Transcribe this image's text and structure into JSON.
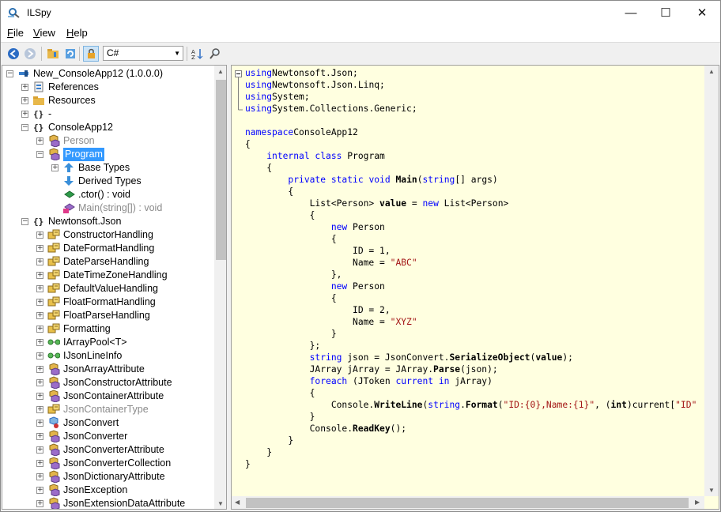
{
  "window": {
    "title": "ILSpy",
    "icon": "ilspy-magnifier-icon",
    "controls": {
      "minimize": "—",
      "maximize": "☐",
      "close": "✕"
    }
  },
  "menu": [
    {
      "label": "File",
      "key": "F",
      "rest": "ile"
    },
    {
      "label": "View",
      "key": "V",
      "rest": "iew"
    },
    {
      "label": "Help",
      "key": "H",
      "rest": "elp"
    }
  ],
  "toolbar": {
    "language": "C#",
    "icons": [
      "back-icon",
      "forward-icon",
      "open-icon",
      "reload-icon",
      "show-internal-icon",
      "sort-icon",
      "search-icon"
    ]
  },
  "tree": [
    {
      "label": "New_ConsoleApp12 (1.0.0.0)",
      "icon": "assembly-icon",
      "expander": "−",
      "style": "normal"
    },
    {
      "label": "References",
      "icon": "references-icon",
      "expander": "+",
      "style": "normal"
    },
    {
      "label": "Resources",
      "icon": "folder-icon",
      "expander": "+",
      "style": "normal"
    },
    {
      "label": "-",
      "icon": "namespace-icon",
      "expander": "+",
      "style": "normal"
    },
    {
      "label": "ConsoleApp12",
      "icon": "namespace-icon",
      "expander": "−",
      "style": "normal"
    },
    {
      "label": "Person",
      "icon": "class-icon",
      "expander": "+",
      "style": "grey"
    },
    {
      "label": "Program",
      "icon": "class-icon",
      "expander": "−",
      "style": "selected"
    },
    {
      "label": "Base Types",
      "icon": "base-types-icon",
      "expander": "+",
      "style": "normal"
    },
    {
      "label": "Derived Types",
      "icon": "derived-types-icon",
      "expander": "",
      "style": "normal"
    },
    {
      "label": ".ctor() : void",
      "icon": "method-icon",
      "expander": "",
      "style": "normal"
    },
    {
      "label": "Main(string[]) : void",
      "icon": "private-method-icon",
      "expander": "",
      "style": "grey"
    },
    {
      "label": "Newtonsoft.Json",
      "icon": "namespace-icon",
      "expander": "−",
      "style": "normal"
    },
    {
      "label": "ConstructorHandling",
      "icon": "enum-icon",
      "expander": "+",
      "style": "normal"
    },
    {
      "label": "DateFormatHandling",
      "icon": "enum-icon",
      "expander": "+",
      "style": "normal"
    },
    {
      "label": "DateParseHandling",
      "icon": "enum-icon",
      "expander": "+",
      "style": "normal"
    },
    {
      "label": "DateTimeZoneHandling",
      "icon": "enum-icon",
      "expander": "+",
      "style": "normal"
    },
    {
      "label": "DefaultValueHandling",
      "icon": "enum-icon",
      "expander": "+",
      "style": "normal"
    },
    {
      "label": "FloatFormatHandling",
      "icon": "enum-icon",
      "expander": "+",
      "style": "normal"
    },
    {
      "label": "FloatParseHandling",
      "icon": "enum-icon",
      "expander": "+",
      "style": "normal"
    },
    {
      "label": "Formatting",
      "icon": "enum-icon",
      "expander": "+",
      "style": "normal"
    },
    {
      "label": "IArrayPool<T>",
      "icon": "interface-icon",
      "expander": "+",
      "style": "normal"
    },
    {
      "label": "IJsonLineInfo",
      "icon": "interface-icon",
      "expander": "+",
      "style": "normal"
    },
    {
      "label": "JsonArrayAttribute",
      "icon": "class-icon",
      "expander": "+",
      "style": "normal"
    },
    {
      "label": "JsonConstructorAttribute",
      "icon": "class-icon",
      "expander": "+",
      "style": "normal"
    },
    {
      "label": "JsonContainerAttribute",
      "icon": "class-icon",
      "expander": "+",
      "style": "normal"
    },
    {
      "label": "JsonContainerType",
      "icon": "enum-icon",
      "expander": "+",
      "style": "grey"
    },
    {
      "label": "JsonConvert",
      "icon": "static-class-icon",
      "expander": "+",
      "style": "normal"
    },
    {
      "label": "JsonConverter",
      "icon": "class-icon",
      "expander": "+",
      "style": "normal"
    },
    {
      "label": "JsonConverterAttribute",
      "icon": "class-icon",
      "expander": "+",
      "style": "normal"
    },
    {
      "label": "JsonConverterCollection",
      "icon": "class-icon",
      "expander": "+",
      "style": "normal"
    },
    {
      "label": "JsonDictionaryAttribute",
      "icon": "class-icon",
      "expander": "+",
      "style": "normal"
    },
    {
      "label": "JsonException",
      "icon": "class-icon",
      "expander": "+",
      "style": "normal"
    },
    {
      "label": "JsonExtensionDataAttribute",
      "icon": "class-icon",
      "expander": "+",
      "style": "normal"
    }
  ],
  "code_lines": [
    [
      [
        "kw",
        "using"
      ],
      [
        "",
        "Newtonsoft.Json;"
      ]
    ],
    [
      [
        "kw",
        "using"
      ],
      [
        "",
        "Newtonsoft.Json.Linq;"
      ]
    ],
    [
      [
        "kw",
        "using"
      ],
      [
        "",
        "System;"
      ]
    ],
    [
      [
        "kw",
        "using"
      ],
      [
        "",
        "System.Collections.Generic;"
      ]
    ],
    [],
    [
      [
        "kw",
        "namespace"
      ],
      [
        "",
        "ConsoleApp12"
      ]
    ],
    [
      [
        "",
        "{"
      ]
    ],
    [
      [
        "",
        "    "
      ],
      [
        "kw",
        "internal class"
      ],
      [
        "",
        " Program"
      ]
    ],
    [
      [
        "",
        "    {"
      ]
    ],
    [
      [
        "",
        "        "
      ],
      [
        "kw",
        "private static void"
      ],
      [
        "",
        " "
      ],
      [
        "b",
        "Main"
      ],
      [
        "",
        "("
      ],
      [
        "kw",
        "string"
      ],
      [
        "",
        "[] args)"
      ]
    ],
    [
      [
        "",
        "        {"
      ]
    ],
    [
      [
        "",
        "            List<Person> "
      ],
      [
        "b",
        "value"
      ],
      [
        "",
        " = "
      ],
      [
        "kw",
        "new"
      ],
      [
        "",
        " List<Person>"
      ]
    ],
    [
      [
        "",
        "            {"
      ]
    ],
    [
      [
        "",
        "                "
      ],
      [
        "kw",
        "new"
      ],
      [
        "",
        " Person"
      ]
    ],
    [
      [
        "",
        "                {"
      ]
    ],
    [
      [
        "",
        "                    ID = 1,"
      ]
    ],
    [
      [
        "",
        "                    Name = "
      ],
      [
        "str",
        "\"ABC\""
      ]
    ],
    [
      [
        "",
        "                },"
      ]
    ],
    [
      [
        "",
        "                "
      ],
      [
        "kw",
        "new"
      ],
      [
        "",
        " Person"
      ]
    ],
    [
      [
        "",
        "                {"
      ]
    ],
    [
      [
        "",
        "                    ID = 2,"
      ]
    ],
    [
      [
        "",
        "                    Name = "
      ],
      [
        "str",
        "\"XYZ\""
      ]
    ],
    [
      [
        "",
        "                }"
      ]
    ],
    [
      [
        "",
        "            };"
      ]
    ],
    [
      [
        "",
        "            "
      ],
      [
        "kw",
        "string"
      ],
      [
        "",
        " json = JsonConvert."
      ],
      [
        "b",
        "SerializeObject"
      ],
      [
        "",
        "("
      ],
      [
        "b",
        "value"
      ],
      [
        "",
        ");"
      ]
    ],
    [
      [
        "",
        "            JArray jArray = JArray."
      ],
      [
        "b",
        "Parse"
      ],
      [
        "",
        "(json);"
      ]
    ],
    [
      [
        "",
        "            "
      ],
      [
        "kw",
        "foreach"
      ],
      [
        "",
        " (JToken "
      ],
      [
        "kw",
        "current"
      ],
      [
        "",
        " "
      ],
      [
        "kw",
        "in"
      ],
      [
        "",
        " jArray)"
      ]
    ],
    [
      [
        "",
        "            {"
      ]
    ],
    [
      [
        "",
        "                Console."
      ],
      [
        "b",
        "WriteLine"
      ],
      [
        "",
        "("
      ],
      [
        "kw",
        "string"
      ],
      [
        "",
        "."
      ],
      [
        "b",
        "Format"
      ],
      [
        "",
        "("
      ],
      [
        "str",
        "\"ID:{0},Name:{1}\""
      ],
      [
        "",
        ", ("
      ],
      [
        "b",
        "int"
      ],
      [
        "",
        ")current["
      ],
      [
        "str",
        "\"ID\""
      ]
    ],
    [
      [
        "",
        "            }"
      ]
    ],
    [
      [
        "",
        "            Console."
      ],
      [
        "b",
        "ReadKey"
      ],
      [
        "",
        "();"
      ]
    ],
    [
      [
        "",
        "        }"
      ]
    ],
    [
      [
        "",
        "    }"
      ]
    ],
    [
      [
        "",
        "}"
      ]
    ]
  ],
  "colors": {
    "code_bg": "#ffffe0",
    "keyword": "#0000ff",
    "string": "#a31515",
    "selection": "#3399ff"
  }
}
